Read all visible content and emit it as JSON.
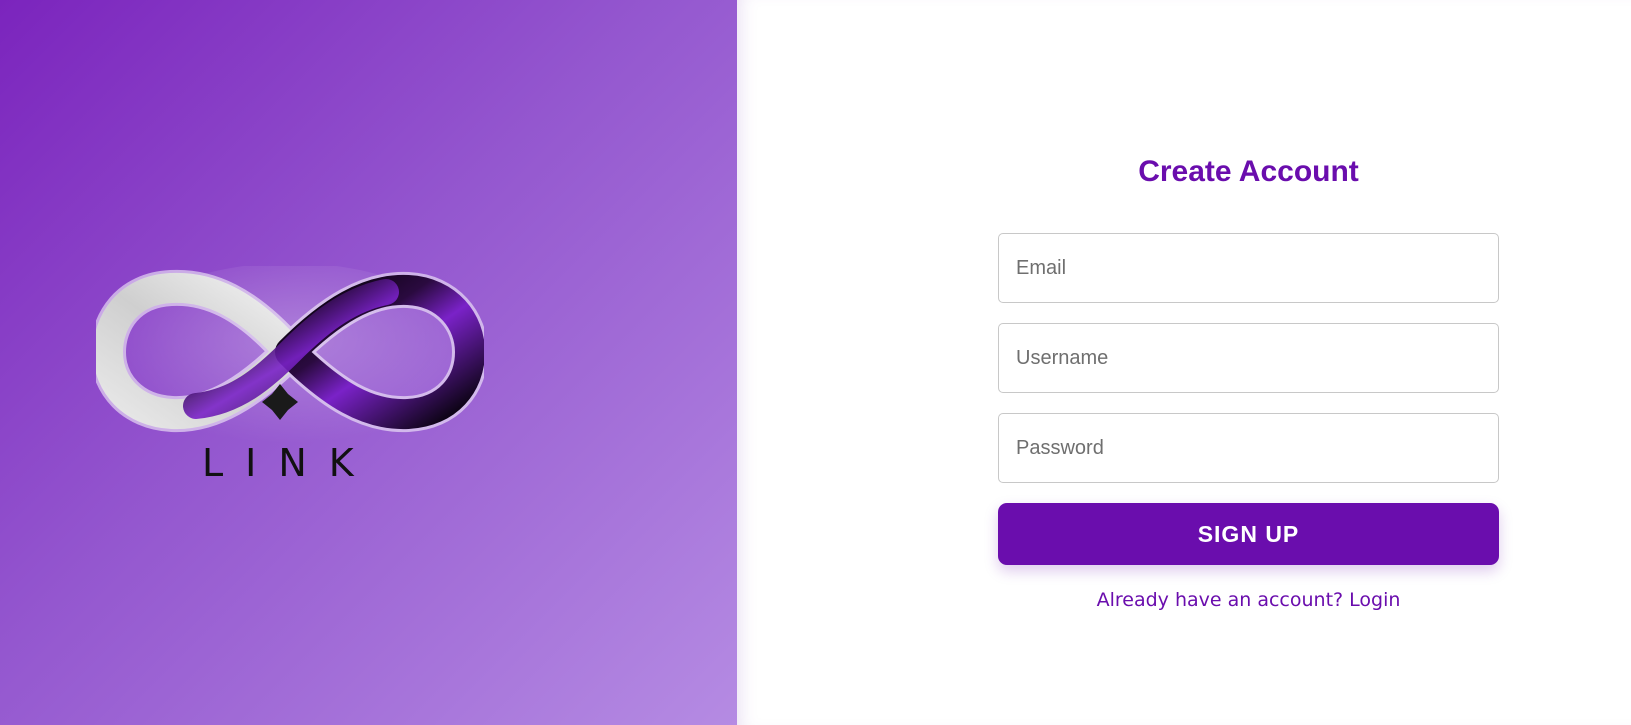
{
  "brand": {
    "logo_text": "LINK",
    "logo_icon": "infinity-icon",
    "sparkle_icon": "sparkle-icon",
    "gradient_colors": [
      "#7b24bd",
      "#9457cf",
      "#b58be3"
    ]
  },
  "form": {
    "title": "Create Account",
    "email_placeholder": "Email",
    "username_placeholder": "Username",
    "password_placeholder": "Password",
    "email_value": "",
    "username_value": "",
    "password_value": "",
    "submit_label": "SIGN UP",
    "login_link_text": "Already have an account? Login"
  },
  "colors": {
    "accent": "#6a0dad",
    "input_border": "#c8c8c8",
    "background": "#ffffff"
  }
}
